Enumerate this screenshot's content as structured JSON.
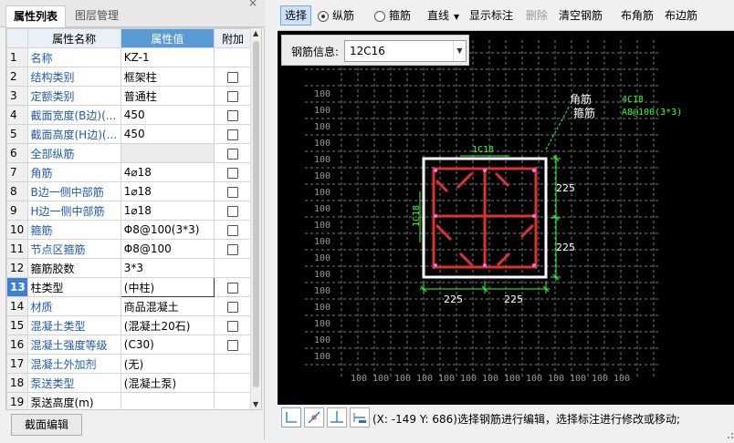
{
  "left_panel": {
    "tabs": [
      {
        "label": "属性列表"
      },
      {
        "label": "图层管理"
      }
    ],
    "close": "×",
    "columns": {
      "name": "属性名称",
      "value": "属性值",
      "extra": "附加"
    },
    "rows": [
      {
        "num": "1",
        "name": "名称",
        "value": "KZ-1",
        "checkbox": false
      },
      {
        "num": "2",
        "name": "结构类别",
        "value": "框架柱",
        "checkbox": true
      },
      {
        "num": "3",
        "name": "定额类别",
        "value": "普通柱",
        "checkbox": true
      },
      {
        "num": "4",
        "name": "截面宽度(B边)(...",
        "value": "450",
        "checkbox": true
      },
      {
        "num": "5",
        "name": "截面高度(H边)(...",
        "value": "450",
        "checkbox": true
      },
      {
        "num": "6",
        "name": "全部纵筋",
        "value": "",
        "checkbox": true
      },
      {
        "num": "7",
        "name": "角筋",
        "value": "4⌀18",
        "checkbox": true
      },
      {
        "num": "8",
        "name": "B边一侧中部筋",
        "value": "1⌀18",
        "checkbox": true
      },
      {
        "num": "9",
        "name": "H边一侧中部筋",
        "value": "1⌀18",
        "checkbox": true
      },
      {
        "num": "10",
        "name": "箍筋",
        "value": "Φ8@100(3*3)",
        "checkbox": true
      },
      {
        "num": "11",
        "name": "节点区箍筋",
        "value": "Φ8@100",
        "checkbox": true
      },
      {
        "num": "12",
        "name": "箍筋胶数",
        "value": "3*3",
        "checkbox": false
      },
      {
        "num": "13",
        "name": "柱类型",
        "value": "(中柱)",
        "checkbox": true
      },
      {
        "num": "14",
        "name": "材质",
        "value": "商品混凝土",
        "checkbox": true
      },
      {
        "num": "15",
        "name": "混凝土类型",
        "value": "(混凝土20石)",
        "checkbox": true
      },
      {
        "num": "16",
        "name": "混凝土强度等级",
        "value": "(C30)",
        "checkbox": true
      },
      {
        "num": "17",
        "name": "混凝土外加剂",
        "value": "(无)",
        "checkbox": false
      },
      {
        "num": "18",
        "name": "泵送类型",
        "value": "(混凝土泵)",
        "checkbox": false
      },
      {
        "num": "19",
        "name": "泵送高度(m)",
        "value": "",
        "checkbox": false
      }
    ],
    "section_edit_button": "截面编辑"
  },
  "toolbar": {
    "select": "选择",
    "longitudinal": "纵筋",
    "stirrup": "箍筋",
    "line": "直线",
    "show_label": "显示标注",
    "delete": "删除",
    "clear_rebar": "清空钢筋",
    "corner_rebar": "布角筋",
    "edge_rebar": "布边筋"
  },
  "canvas": {
    "rebar_info_label": "钢筋信息:",
    "rebar_info_value": "12C16",
    "label_corner": "角筋",
    "label_stirrup": "箍筋",
    "label_4c18": "4C18",
    "label_stirrup_spec": "A8@100(3*3)",
    "label_1c18_top": "1C18",
    "label_1c18_left": "1C18",
    "dim_right_top": "225",
    "dim_right_bottom": "225",
    "dim_bottom_left": "225",
    "dim_bottom_right": "225",
    "grid_label": "100",
    "colors": {
      "background": "#000000",
      "section": "#ffffff",
      "rebar": "#e03030",
      "dimension": "#33ff33",
      "grid": "#808080"
    }
  },
  "status": {
    "text": "(X: -149 Y: 686)选择钢筋进行编辑，选择标注进行修改或移动;"
  }
}
